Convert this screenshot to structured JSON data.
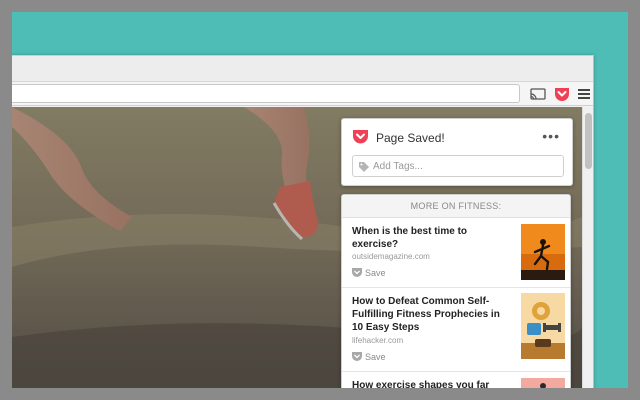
{
  "pocket": {
    "saved_title": "Page Saved!",
    "more_icon": "more-dots-icon",
    "tags_placeholder": "Add Tags..."
  },
  "recommendations": {
    "header": "MORE ON FITNESS:",
    "items": [
      {
        "title": "When is the best time to exercise?",
        "source": "outsidemagazine.com",
        "save_label": "Save"
      },
      {
        "title": "How to Defeat Common Self-Fulfilling Fitness Prophecies in 10 Easy Steps",
        "source": "lifehacker.com",
        "save_label": "Save"
      },
      {
        "title": "How exercise shapes you far"
      }
    ]
  },
  "colors": {
    "pocket_red": "#ef4056",
    "background_teal": "#4dbdb5"
  },
  "icons": [
    "cast-icon",
    "pocket-icon",
    "hamburger-menu-icon",
    "tag-icon",
    "save-pocket-icon"
  ]
}
